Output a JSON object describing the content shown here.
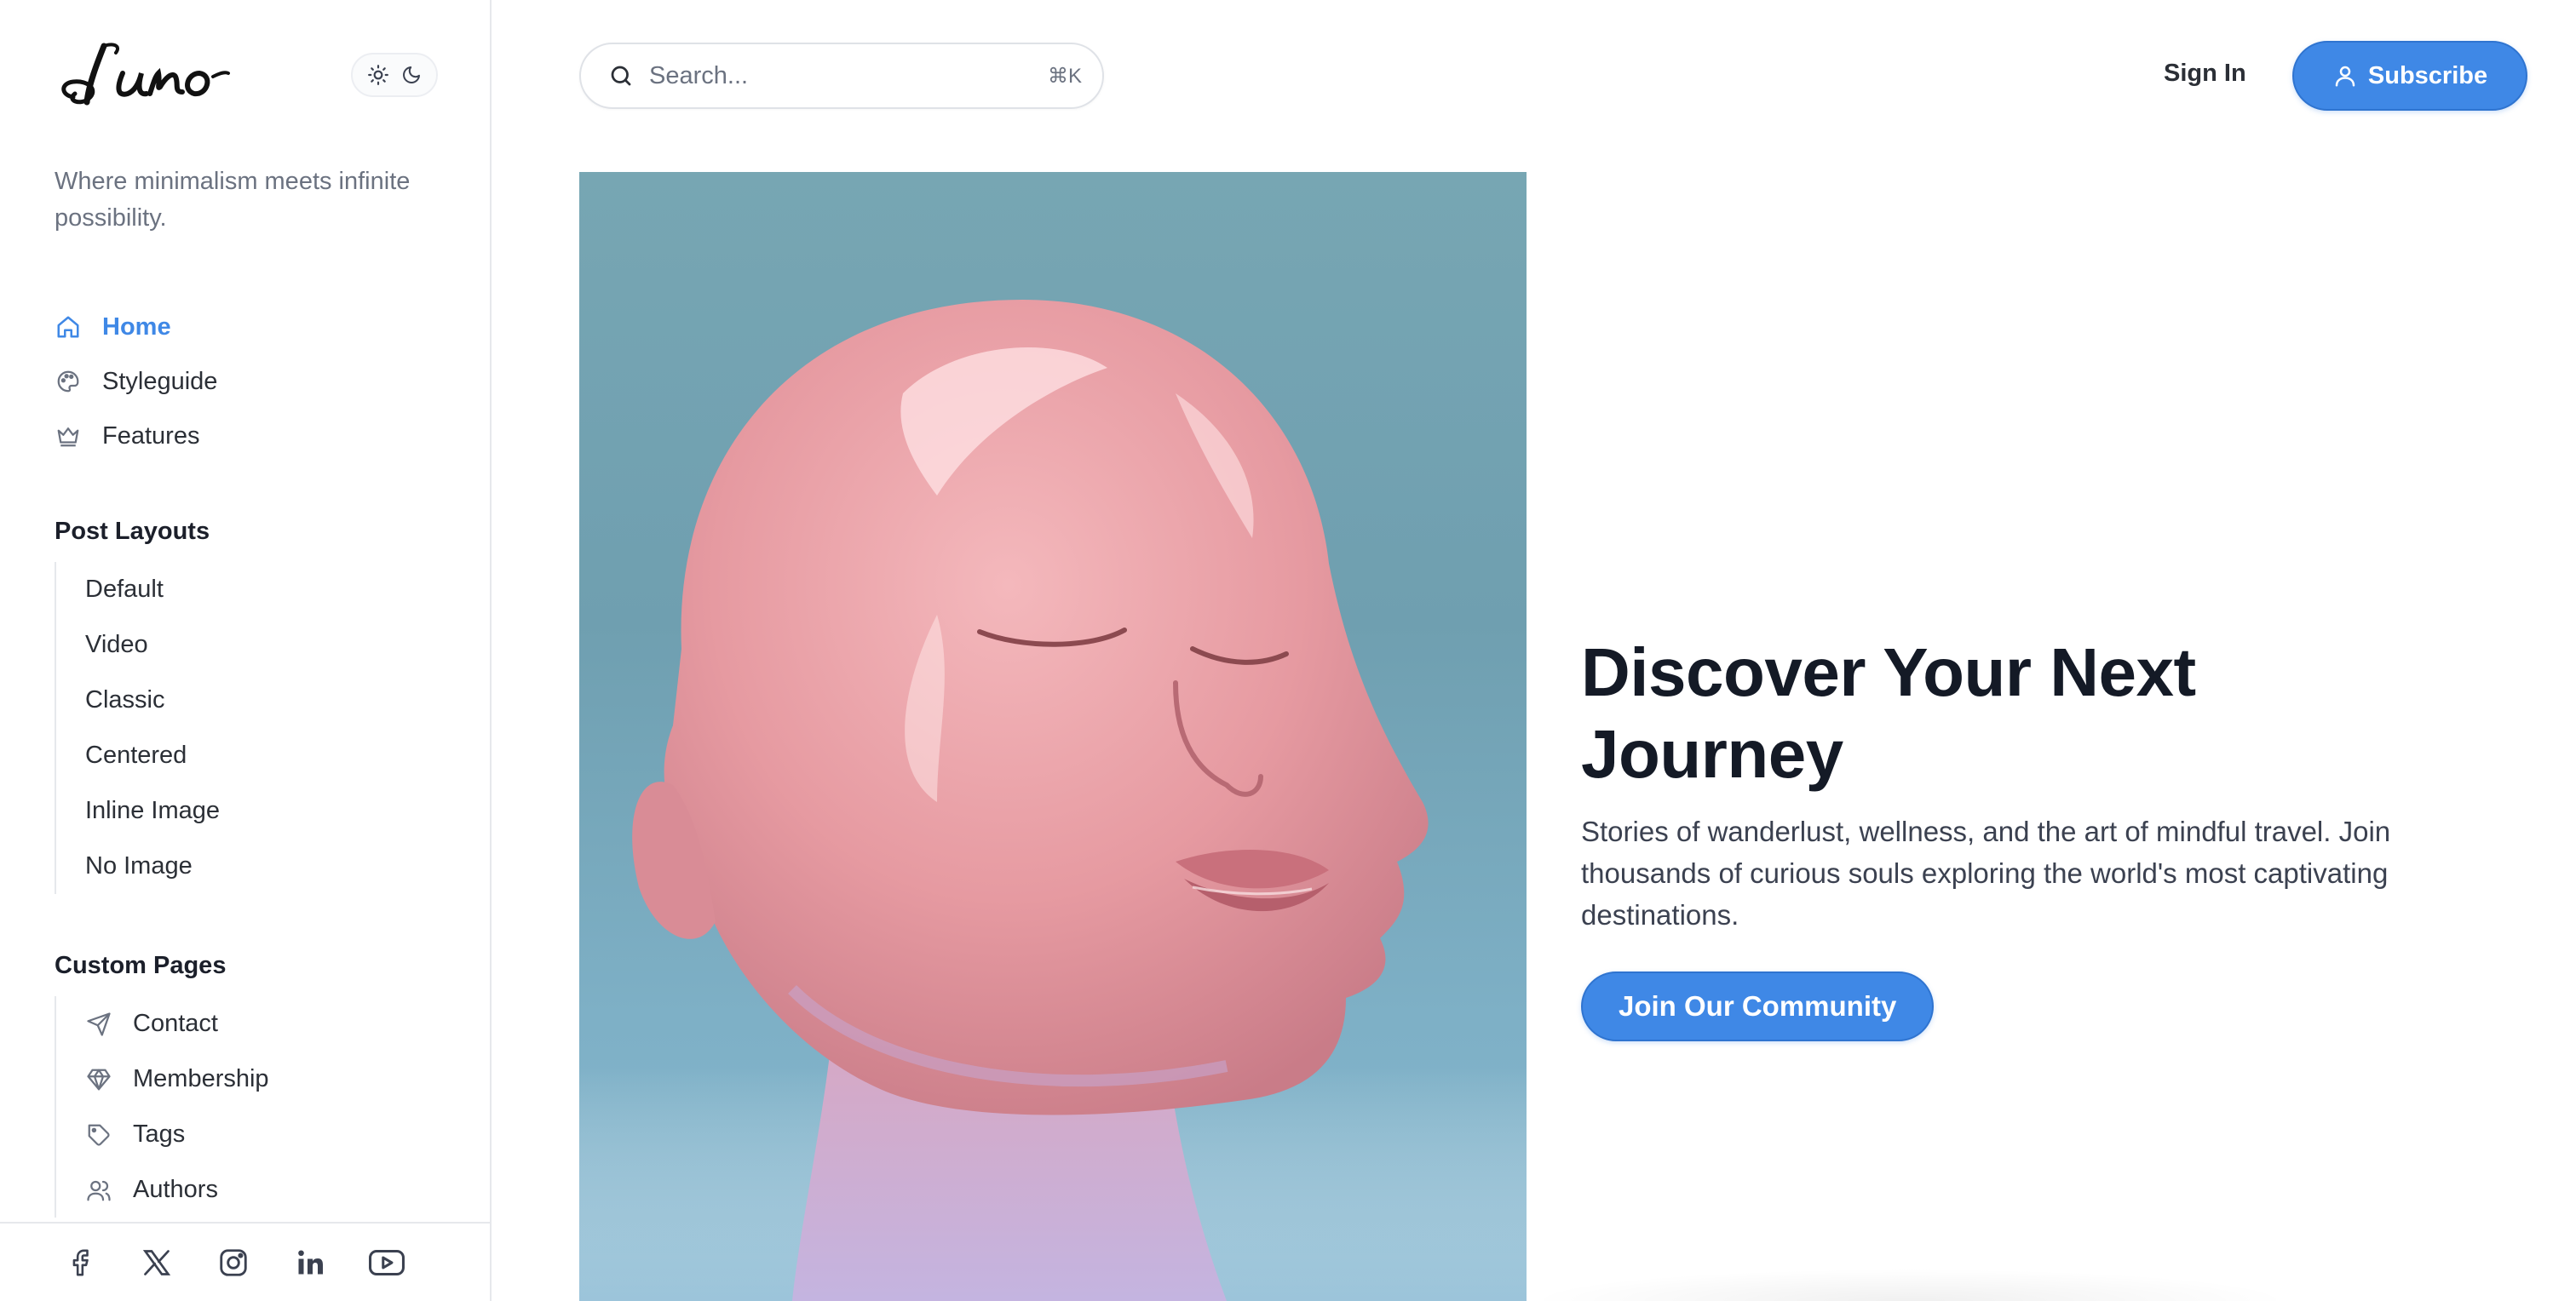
{
  "brand": {
    "logo_text": "Luno"
  },
  "tagline": "Where minimalism meets infinite possibility.",
  "nav": {
    "main": [
      {
        "label": "Home",
        "icon": "home-icon",
        "active": true
      },
      {
        "label": "Styleguide",
        "icon": "palette-icon",
        "active": false
      },
      {
        "label": "Features",
        "icon": "crown-icon",
        "active": false
      }
    ],
    "post_layouts": {
      "title": "Post Layouts",
      "items": [
        "Default",
        "Video",
        "Classic",
        "Centered",
        "Inline Image",
        "No Image"
      ]
    },
    "custom_pages": {
      "title": "Custom Pages",
      "items": [
        {
          "label": "Contact",
          "icon": "send-icon"
        },
        {
          "label": "Membership",
          "icon": "diamond-icon"
        },
        {
          "label": "Tags",
          "icon": "tag-icon"
        },
        {
          "label": "Authors",
          "icon": "users-icon"
        }
      ]
    }
  },
  "social": [
    "facebook-icon",
    "x-icon",
    "instagram-icon",
    "linkedin-icon",
    "youtube-icon"
  ],
  "header": {
    "search_placeholder": "Search...",
    "search_shortcut": "⌘K",
    "signin_label": "Sign In",
    "subscribe_label": "Subscribe"
  },
  "hero": {
    "title": "Discover Your Next Journey",
    "subtitle": "Stories of wanderlust, wellness, and the art of mindful travel. Join thousands of curious souls exploring the world's most captivating destinations.",
    "cta_label": "Join Our Community"
  },
  "colors": {
    "accent": "#3f88e6",
    "text": "#1b1f2a",
    "muted": "#6b7280",
    "border": "#e6e8ec",
    "hero_bg": "#77a6b3",
    "head_pink": "#e9a0a6"
  }
}
